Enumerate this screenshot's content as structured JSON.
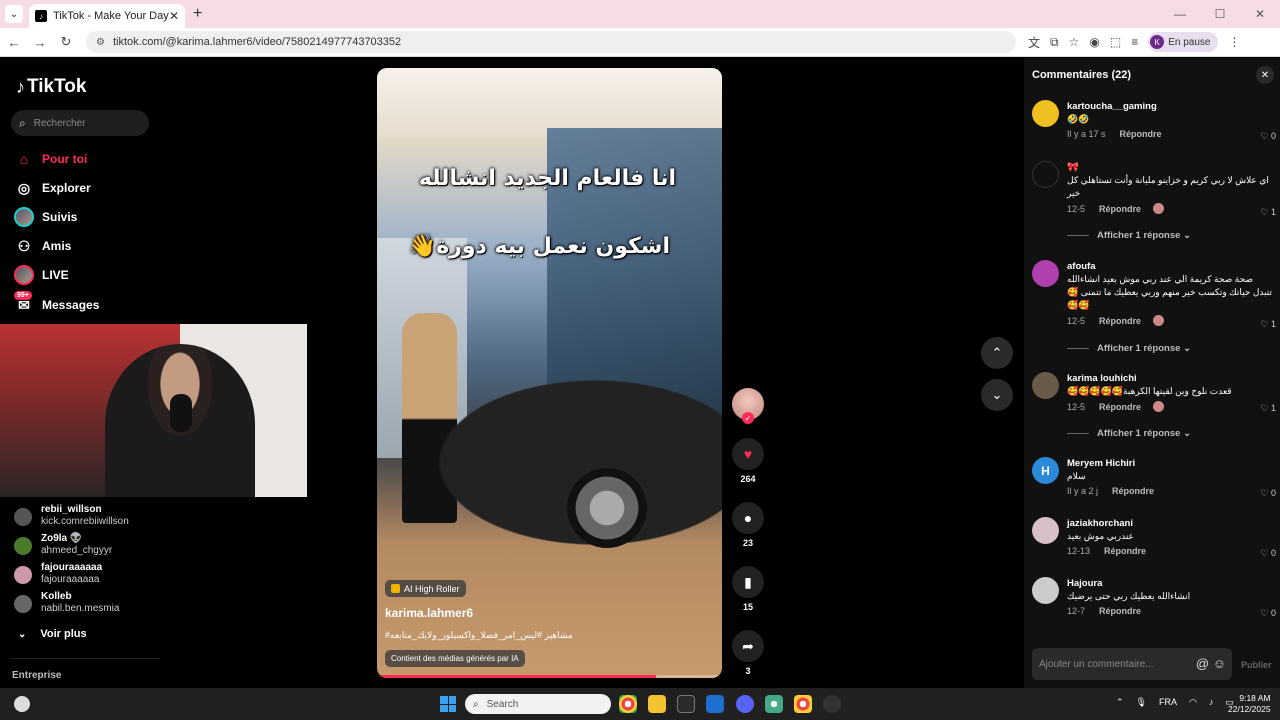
{
  "browser": {
    "tab_title": "TikTok - Make Your Day",
    "url": "tiktok.com/@karima.lahmer6/video/7580214977743703352",
    "profile_label": "En pause",
    "profile_initial": "K"
  },
  "sidebar": {
    "logo": "TikTok",
    "search_placeholder": "Rechercher",
    "menu": [
      {
        "label": "Pour toi",
        "icon": "home-icon",
        "active": true
      },
      {
        "label": "Explorer",
        "icon": "compass-icon"
      },
      {
        "label": "Suivis",
        "icon": "following-avatar-icon"
      },
      {
        "label": "Amis",
        "icon": "friends-icon"
      },
      {
        "label": "LIVE",
        "icon": "live-icon"
      },
      {
        "label": "Messages",
        "icon": "messages-icon",
        "badge": "99+"
      }
    ],
    "following": [
      {
        "name": "rebii_willson",
        "sub": "kick.comrebiiwillson"
      },
      {
        "name": "Zo9la 👽",
        "sub": "ahmeed_chgyyr"
      },
      {
        "name": "fajouraaaaaa",
        "sub": "fajouraaaaaa"
      },
      {
        "name": "Kolleb",
        "sub": "nabil.ben.mesmia"
      }
    ],
    "see_more": "Voir plus",
    "footer": "Entreprise"
  },
  "video": {
    "caption_line1": "انا فالعام الجديد انشالله",
    "caption_line2": "اشكون نعمل بيه دورة👋",
    "ai_badge": "AI High Roller",
    "author": "karima.lahmer6",
    "tags": "#مشاهير #ليس_امر_فضلا_واكسبلور_ولايك_متابعه",
    "ai_note": "Contient des médias générés par IA",
    "progress": 0.81
  },
  "actions": {
    "likes": "264",
    "comments": "23",
    "saves": "15",
    "shares": "3"
  },
  "comments_panel": {
    "title": "Commentaires (22)",
    "input_placeholder": "Ajouter un commentaire...",
    "post_label": "Publier",
    "reply_label": "Répondre",
    "show_replies": "Afficher 1 réponse",
    "items": [
      {
        "user": "kartoucha__gaming",
        "text": "🤣🤣",
        "date": "Il y a 17 s",
        "likes": "0"
      },
      {
        "user": "🎀",
        "text": "اي علاش لا ربي كريم و خزاينو مليانة وأنت تستاهلي كل خير",
        "date": "12-5",
        "likes": "1"
      },
      {
        "user": "afoufa",
        "text": "صحة صحة كريمة الي عند ربي موش بعيد انشاءالله تتبدل حياتك وتكسب خير منهم وربي يعطيك ما تتمنى 🥰🥰🥰",
        "date": "12-5",
        "likes": "1"
      },
      {
        "user": "karima louhichi",
        "text": "قعدت نلوج وين لقيتها الكرهبة🥰🥰🥰🥰🥰",
        "date": "12-5",
        "likes": "1"
      },
      {
        "user": "Meryem Hichiri",
        "text": "سلام",
        "date": "Il y a 2 j",
        "likes": "0",
        "initial": "H"
      },
      {
        "user": "jaziakhorchani",
        "text": "عندربي موش بعيد",
        "date": "12-13",
        "likes": "0"
      },
      {
        "user": "Hajoura",
        "text": "انشاءالله يعطيك ربي حتى يرضيك",
        "date": "12-7",
        "likes": "0"
      }
    ]
  },
  "taskbar": {
    "search": "Search",
    "lang": "FRA",
    "time": "9:18 AM",
    "date": "22/12/2025"
  },
  "colors": {
    "accent": "#fe2c55",
    "tabbar": "#f6dde4",
    "panel": "#111111"
  }
}
